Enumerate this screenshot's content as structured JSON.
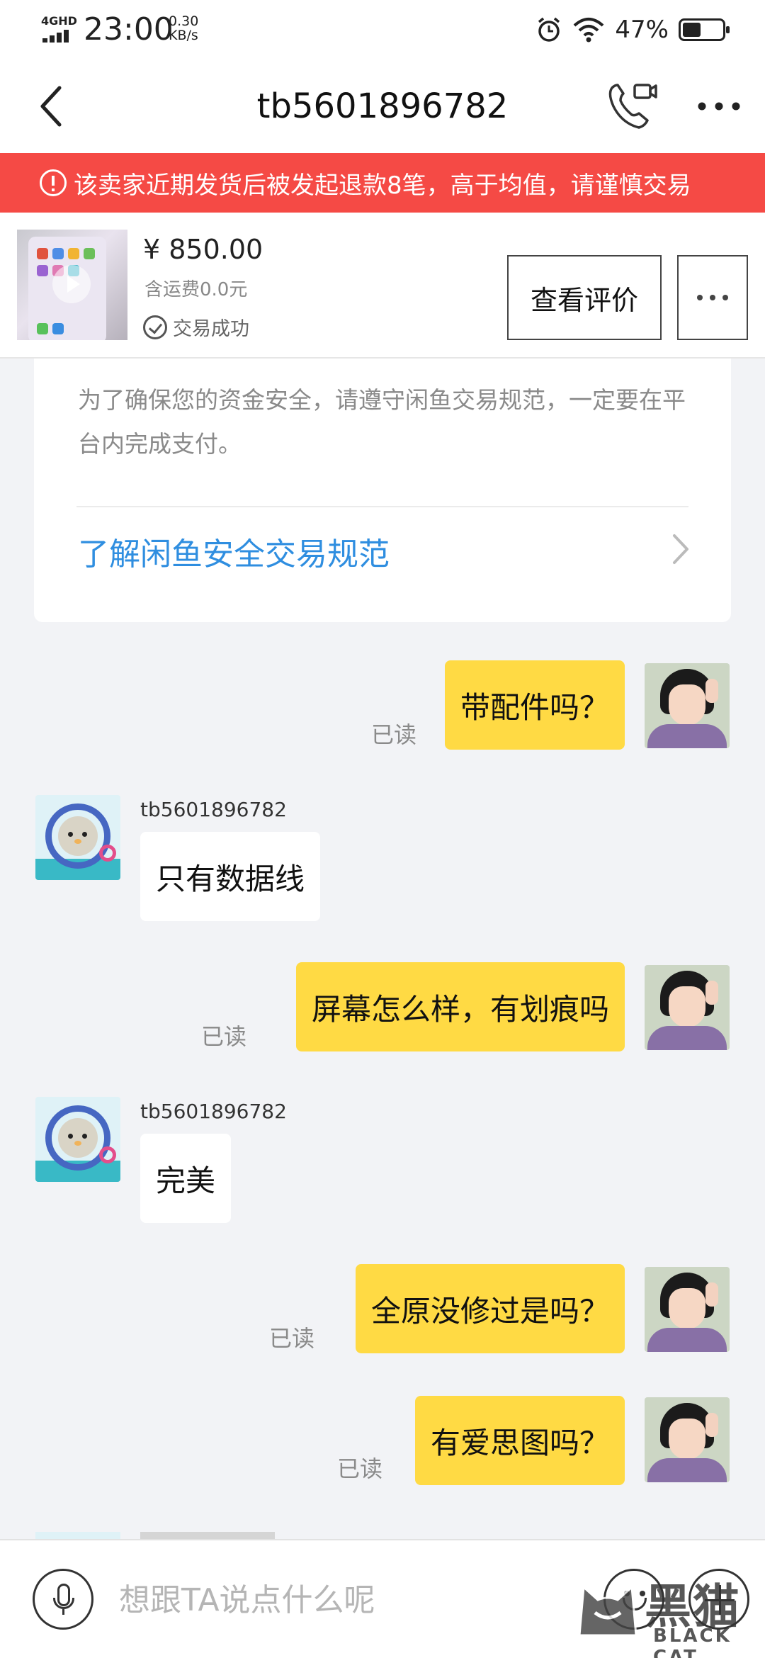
{
  "status_bar": {
    "network": "4GHD",
    "time": "23:00",
    "speed_value": "0.30",
    "speed_unit": "KB/s",
    "battery": "47%",
    "battery_level": 0.47,
    "icons": [
      "signal-icon",
      "alarm-icon",
      "wifi-icon",
      "battery-icon"
    ]
  },
  "header": {
    "title": "tb5601896782",
    "back_icon": "chevron-left-icon",
    "call_icon": "video-call-icon",
    "more_icon": "more-dots-icon"
  },
  "warning": {
    "text": "该卖家近期发货后被发起退款8笔，高于均值，请谨慎交易",
    "icon": "alert-icon",
    "color": "#f54a45"
  },
  "product": {
    "price": "¥ 850.00",
    "shipping": "含运费0.0元",
    "status": "交易成功",
    "review_button": "查看评价",
    "thumbnail_icon": "video-play-icon"
  },
  "notice": {
    "body": "为了确保您的资金安全，请遵守闲鱼交易规范，一定要在平台内完成支付。",
    "link": "了解闲鱼安全交易规范",
    "link_color": "#2f8ee0"
  },
  "messages": [
    {
      "side": "me",
      "text": "带配件吗？",
      "read": "已读"
    },
    {
      "side": "them",
      "sender": "tb5601896782",
      "text": "只有数据线"
    },
    {
      "side": "me",
      "text": "屏幕怎么样，有划痕吗",
      "read": "已读"
    },
    {
      "side": "them",
      "sender": "tb5601896782",
      "text": "完美"
    },
    {
      "side": "me",
      "text": "全原没修过是吗？",
      "read": "已读"
    },
    {
      "side": "me",
      "text": "有爱思图吗？",
      "read": "已读"
    }
  ],
  "input": {
    "placeholder": "想跟TA说点什么呢",
    "voice_icon": "microphone-icon",
    "emoji_icon": "emoji-icon",
    "plus_icon": "plus-icon"
  },
  "watermark": {
    "title": "黑猫",
    "subtitle": "BLACK CAT"
  },
  "colors": {
    "my_bubble": "#ffda44",
    "their_bubble": "#ffffff",
    "background": "#f2f3f6"
  }
}
